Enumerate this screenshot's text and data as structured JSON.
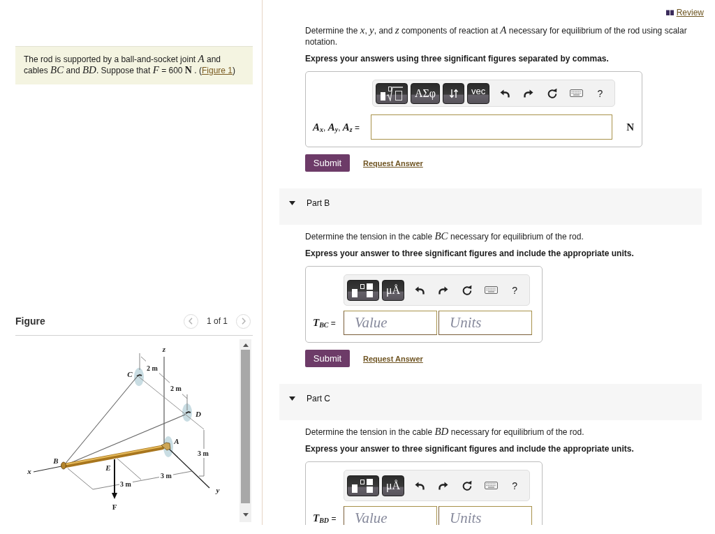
{
  "review_link": "Review",
  "problem": {
    "text": "The rod is supported by a ball-and-socket joint *A* and cables *BC* and *BD*. Suppose that *F* = 600 **N** . (",
    "figure_link": "Figure 1",
    "text_after": ")"
  },
  "figure": {
    "title": "Figure",
    "pager": "1 of 1",
    "labels": [
      "z",
      "2 m",
      "C",
      "2 m",
      "D",
      "A",
      "3 m",
      "B",
      "x",
      "E",
      "3 m",
      "3 m",
      "y",
      "F"
    ]
  },
  "parts": [
    {
      "question": "Determine the *x*, *y*, and *z* components of reaction at *A* necessary for equilibrium of the rod using scalar notation.",
      "instruction": "Express your answers using three significant figures separated by commas.",
      "answer": {
        "kind": "single",
        "toolbar": [
          {
            "kind": "root_template"
          },
          {
            "kind": "symbols",
            "label": "ΑΣφ"
          },
          {
            "kind": "arrows"
          },
          {
            "kind": "text",
            "label": "vec"
          },
          {
            "kind": "undo"
          },
          {
            "kind": "redo"
          },
          {
            "kind": "reset"
          },
          {
            "kind": "keyboard"
          },
          {
            "kind": "help",
            "label": "?"
          }
        ],
        "label": "*A*$_{x}$, *A*$_{y}$, *A*$_{z}$ =",
        "unit": "N"
      },
      "actions": {
        "submit": "Submit",
        "request": "Request Answer"
      }
    },
    {
      "title": "Part B",
      "expanded": true,
      "question": "Determine the tension in the cable *BC* necessary for equilibrium of the rod.",
      "instruction": "Express your answer to three significant figures and include the appropriate units.",
      "answer": {
        "kind": "value_units",
        "toolbar": [
          {
            "kind": "fraction_template"
          },
          {
            "kind": "symbols",
            "label": "μÅ"
          },
          {
            "kind": "undo"
          },
          {
            "kind": "redo"
          },
          {
            "kind": "reset"
          },
          {
            "kind": "keyboard"
          },
          {
            "kind": "help",
            "label": "?"
          }
        ],
        "label": "*T*$_{BC}$ =",
        "value_placeholder": "Value",
        "units_placeholder": "Units"
      },
      "actions": {
        "submit": "Submit",
        "request": "Request Answer"
      }
    },
    {
      "title": "Part C",
      "expanded": true,
      "question": "Determine the tension in the cable *BD* necessary for equilibrium of the rod.",
      "instruction": "Express your answer to three significant figures and include the appropriate units.",
      "answer": {
        "kind": "value_units",
        "toolbar": [
          {
            "kind": "fraction_template"
          },
          {
            "kind": "symbols",
            "label": "μÅ"
          },
          {
            "kind": "undo"
          },
          {
            "kind": "redo"
          },
          {
            "kind": "reset"
          },
          {
            "kind": "keyboard"
          },
          {
            "kind": "help",
            "label": "?"
          }
        ],
        "label": "*T*$_{BD}$ =",
        "value_placeholder": "Value",
        "units_placeholder": "Units"
      }
    }
  ]
}
